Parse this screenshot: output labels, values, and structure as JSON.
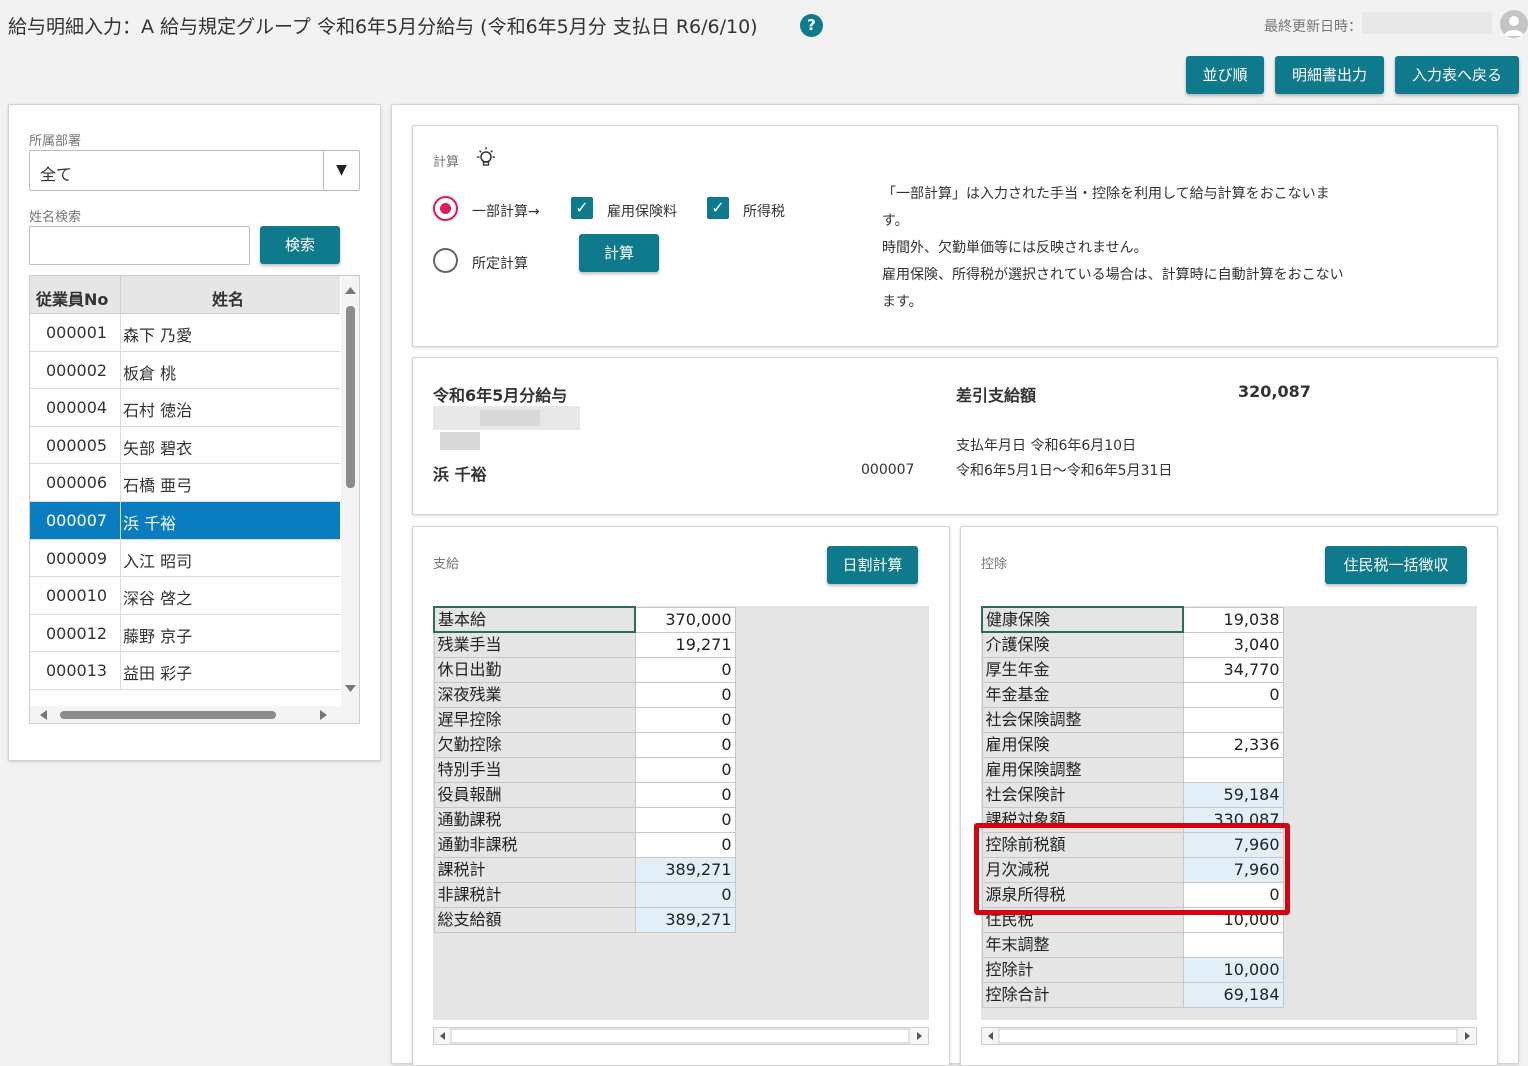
{
  "header": {
    "title": "給与明細入力：A 給与規定グループ 令和6年5月分給与 (令和6年5月分 支払日 R6/6/10)",
    "help_icon": "?",
    "updated_label": "最終更新日時："
  },
  "toolbar": {
    "sort_label": "並び順",
    "print_label": "明細書出力",
    "back_label": "入力表へ戻る"
  },
  "sidebar": {
    "department_label": "所属部署",
    "department_value": "全て",
    "name_search_label": "姓名検索",
    "name_search_value": "",
    "search_button": "検索",
    "columns": [
      "従業員No",
      "姓名"
    ],
    "employees": [
      {
        "no": "000001",
        "name": "森下 乃愛"
      },
      {
        "no": "000002",
        "name": "板倉 桃"
      },
      {
        "no": "000004",
        "name": "石村 徳治"
      },
      {
        "no": "000005",
        "name": "矢部 碧衣"
      },
      {
        "no": "000006",
        "name": "石橋 亜弓"
      },
      {
        "no": "000007",
        "name": "浜 千裕"
      },
      {
        "no": "000009",
        "name": "入江 昭司"
      },
      {
        "no": "000010",
        "name": "深谷 啓之"
      },
      {
        "no": "000012",
        "name": "藤野 京子"
      },
      {
        "no": "000013",
        "name": "益田 彩子"
      }
    ],
    "selected_no": "000007"
  },
  "calc": {
    "label": "計算",
    "option_partial": "一部計算→",
    "option_employment_insurance": "雇用保険料",
    "option_income_tax": "所得税",
    "option_standard": "所定計算",
    "calc_button": "計算",
    "description": [
      "「一部計算」は入力された手当・控除を利用して給与計算をおこないま",
      "す。",
      "時間外、欠勤単価等には反映されません。",
      "雇用保険、所得税が選択されている場合は、計算時に自動計算をおこない",
      "ます。"
    ]
  },
  "summary": {
    "title": "令和6年5月分給与",
    "employee_name": "浜 千裕",
    "employee_no": "000007",
    "net_pay_label": "差引支給額",
    "net_pay_value": "320,087",
    "pay_date": "支払年月日 令和6年6月10日",
    "period": "令和6年5月1日～令和6年5月31日"
  },
  "payments": {
    "label": "支給",
    "button": "日割計算",
    "rows": [
      {
        "label": "基本給",
        "value": "370,000",
        "calc": false
      },
      {
        "label": "残業手当",
        "value": "19,271",
        "calc": false
      },
      {
        "label": "休日出勤",
        "value": "0",
        "calc": false
      },
      {
        "label": "深夜残業",
        "value": "0",
        "calc": false
      },
      {
        "label": "遅早控除",
        "value": "0",
        "calc": false
      },
      {
        "label": "欠勤控除",
        "value": "0",
        "calc": false
      },
      {
        "label": "特別手当",
        "value": "0",
        "calc": false
      },
      {
        "label": "役員報酬",
        "value": "0",
        "calc": false
      },
      {
        "label": "通勤課税",
        "value": "0",
        "calc": false
      },
      {
        "label": "通勤非課税",
        "value": "0",
        "calc": false
      },
      {
        "label": "課税計",
        "value": "389,271",
        "calc": true
      },
      {
        "label": "非課税計",
        "value": "0",
        "calc": true
      },
      {
        "label": "総支給額",
        "value": "389,271",
        "calc": true
      }
    ]
  },
  "deductions": {
    "label": "控除",
    "button": "住民税一括徴収",
    "rows": [
      {
        "label": "健康保険",
        "value": "19,038",
        "calc": false
      },
      {
        "label": "介護保険",
        "value": "3,040",
        "calc": false
      },
      {
        "label": "厚生年金",
        "value": "34,770",
        "calc": false
      },
      {
        "label": "年金基金",
        "value": "0",
        "calc": false
      },
      {
        "label": "社会保険調整",
        "value": "",
        "calc": false
      },
      {
        "label": "雇用保険",
        "value": "2,336",
        "calc": false
      },
      {
        "label": "雇用保険調整",
        "value": "",
        "calc": false
      },
      {
        "label": "社会保険計",
        "value": "59,184",
        "calc": true
      },
      {
        "label": "課税対象額",
        "value": "330,087",
        "calc": true
      },
      {
        "label": "控除前税額",
        "value": "7,960",
        "calc": true
      },
      {
        "label": "月次減税",
        "value": "7,960",
        "calc": true
      },
      {
        "label": "源泉所得税",
        "value": "0",
        "calc": false
      },
      {
        "label": "住民税",
        "value": "10,000",
        "calc": false
      },
      {
        "label": "年末調整",
        "value": "",
        "calc": false
      },
      {
        "label": "控除計",
        "value": "10,000",
        "calc": true
      },
      {
        "label": "控除合計",
        "value": "69,184",
        "calc": true
      }
    ]
  },
  "colors": {
    "accent": "#0e7a8c",
    "selected_row": "#0a7dc0",
    "radio_on": "#e0195a",
    "highlight_box": "#d6000f"
  }
}
